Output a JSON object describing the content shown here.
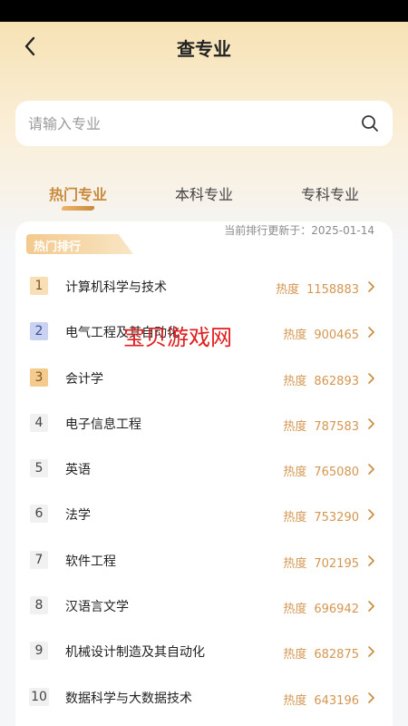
{
  "nav": {
    "title": "查专业"
  },
  "search": {
    "placeholder": "请输入专业"
  },
  "tabs": [
    {
      "label": "热门专业",
      "active": true
    },
    {
      "label": "本科专业",
      "active": false
    },
    {
      "label": "专科专业",
      "active": false
    }
  ],
  "ranking": {
    "tag": "热门排行",
    "update_text": "当前排行更新于：2025-01-14",
    "heat_label": "热度",
    "items": [
      {
        "rank": "1",
        "name": "计算机科学与技术",
        "heat": "1158883"
      },
      {
        "rank": "2",
        "name": "电气工程及其自动化",
        "heat": "900465"
      },
      {
        "rank": "3",
        "name": "会计学",
        "heat": "862893"
      },
      {
        "rank": "4",
        "name": "电子信息工程",
        "heat": "787583"
      },
      {
        "rank": "5",
        "name": "英语",
        "heat": "765080"
      },
      {
        "rank": "6",
        "name": "法学",
        "heat": "753290"
      },
      {
        "rank": "7",
        "name": "软件工程",
        "heat": "702195"
      },
      {
        "rank": "8",
        "name": "汉语言文学",
        "heat": "696942"
      },
      {
        "rank": "9",
        "name": "机械设计制造及其自动化",
        "heat": "682875"
      },
      {
        "rank": "10",
        "name": "数据科学与大数据技术",
        "heat": "643196"
      }
    ]
  },
  "watermark": "宝贝游戏网",
  "colors": {
    "accent": "#c98a3b",
    "heat": "#d49651"
  }
}
